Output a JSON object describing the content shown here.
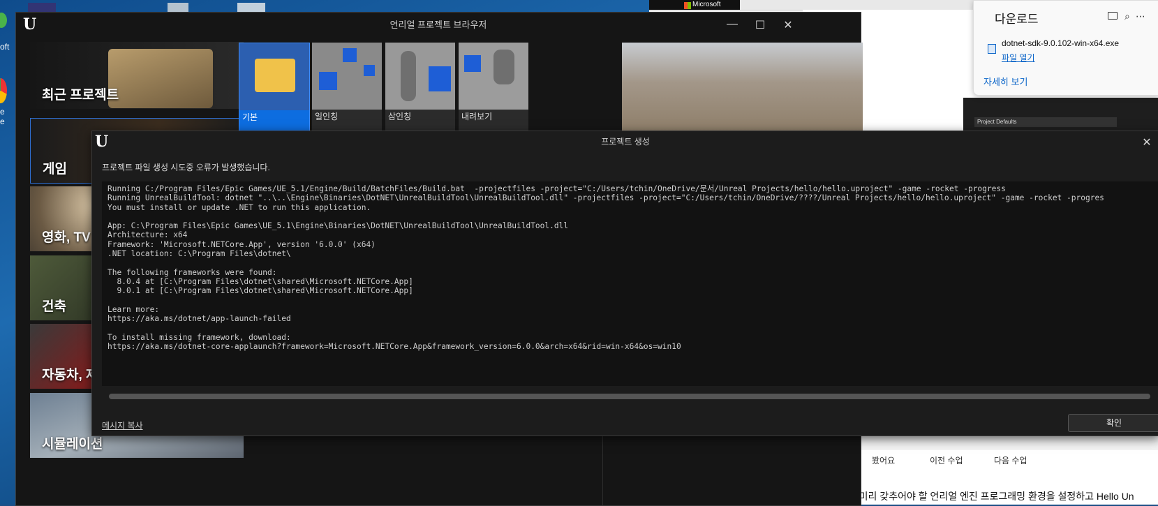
{
  "desktop": {
    "label_1": "oft",
    "label_2": "e",
    "label_3": "e"
  },
  "browser": {
    "ms_logo": "Microsoft",
    "project_defaults": "Project Defaults",
    "nav": [
      "봤어요",
      "이전 수업",
      "다음 수업"
    ],
    "bottom_text": "에, 미리 갖추어야 할 언리얼 엔진 프로그래밍 환경을 설정하고 Hello Un"
  },
  "download_panel": {
    "title": "다운로드",
    "icons": [
      "folder-icon",
      "search-icon",
      "more-icon"
    ],
    "file_name": "dotnet-sdk-9.0.102-win-x64.exe",
    "open_file": "파일 열기",
    "see_more": "자세히 보기"
  },
  "project_browser": {
    "title": "언리얼 프로젝트 브라우저",
    "logo": "U",
    "window_controls": {
      "minimize": "—",
      "maximize": "☐",
      "close": "✕"
    },
    "categories": [
      "최근 프로젝트",
      "게임",
      "영화, TV",
      "건축",
      "자동차, 제",
      "시뮬레이션"
    ],
    "templates": [
      "기본",
      "일인칭",
      "삼인칭",
      "내려보기"
    ]
  },
  "error_dialog": {
    "title": "프로젝트 생성",
    "logo": "U",
    "close": "✕",
    "message": "프로젝트 파일 생성 시도중 오류가 발생했습니다.",
    "log_lines": [
      "Running C:/Program Files/Epic Games/UE_5.1/Engine/Build/BatchFiles/Build.bat  -projectfiles -project=\"C:/Users/tchin/OneDrive/문서/Unreal Projects/hello/hello.uproject\" -game -rocket -progress",
      "Running UnrealBuildTool: dotnet \"..\\..\\Engine\\Binaries\\DotNET\\UnrealBuildTool\\UnrealBuildTool.dll\" -projectfiles -project=\"C:/Users/tchin/OneDrive/????/Unreal Projects/hello/hello.uproject\" -game -rocket -progres",
      "You must install or update .NET to run this application.",
      "",
      "App: C:\\Program Files\\Epic Games\\UE_5.1\\Engine\\Binaries\\DotNET\\UnrealBuildTool\\UnrealBuildTool.dll",
      "Architecture: x64",
      "Framework: 'Microsoft.NETCore.App', version '6.0.0' (x64)",
      ".NET location: C:\\Program Files\\dotnet\\",
      "",
      "The following frameworks were found:",
      "  8.0.4 at [C:\\Program Files\\dotnet\\shared\\Microsoft.NETCore.App]",
      "  9.0.1 at [C:\\Program Files\\dotnet\\shared\\Microsoft.NETCore.App]",
      "",
      "Learn more:",
      "https://aka.ms/dotnet/app-launch-failed",
      "",
      "To install missing framework, download:",
      "https://aka.ms/dotnet-core-applaunch?framework=Microsoft.NETCore.App&framework_version=6.0.0&arch=x64&rid=win-x64&os=win10"
    ],
    "copy_message": "메시지 복사",
    "ok_button": "확인"
  }
}
